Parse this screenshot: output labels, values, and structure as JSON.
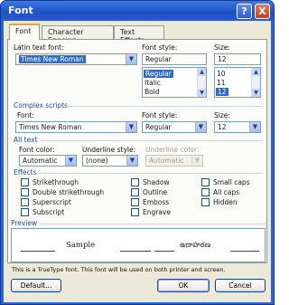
{
  "window": {
    "title": "Font",
    "help_label": "?",
    "close_label": "X"
  },
  "tabs": [
    {
      "label": "Font",
      "active": true
    },
    {
      "label": "Character Spacing",
      "active": false
    },
    {
      "label": "Text Effects",
      "active": false
    }
  ],
  "latin": {
    "font_label": "Latin text font:",
    "font_value": "Times New Roman",
    "style_label": "Font style:",
    "style_value": "Regular",
    "style_options": [
      "Regular",
      "Italic",
      "Bold"
    ],
    "style_selected": "Regular",
    "size_label": "Size:",
    "size_value": "12",
    "size_options": [
      "10",
      "11",
      "12"
    ],
    "size_selected": "12"
  },
  "complex": {
    "section_label": "Complex scripts",
    "font_label": "Font:",
    "font_value": "Times New Roman",
    "style_label": "Font style:",
    "style_value": "Regular",
    "size_label": "Size:",
    "size_value": "12"
  },
  "all_text": {
    "section_label": "All text",
    "font_color_label": "Font color:",
    "font_color_value": "Automatic",
    "underline_style_label": "Underline style:",
    "underline_style_value": "(none)",
    "underline_color_label": "Underline color:",
    "underline_color_value": "Automatic"
  },
  "effects": {
    "section_label": "Effects",
    "col1": [
      "Strikethrough",
      "Double strikethrough",
      "Superscript",
      "Subscript"
    ],
    "col2": [
      "Shadow",
      "Outline",
      "Emboss",
      "Engrave"
    ],
    "col3": [
      "Small caps",
      "All caps",
      "Hidden"
    ]
  },
  "preview": {
    "section_label": "Preview",
    "sample_text": "Sample",
    "complex_sample_text": "ఉదాహరణ",
    "note": "This is a TrueType font. This font will be used on both printer and screen."
  },
  "buttons": {
    "default": "Default...",
    "ok": "OK",
    "cancel": "Cancel"
  },
  "colors": {
    "title_bar": "#1d4fc0",
    "section_text": "#1f4fb0",
    "selection": "#316ac5",
    "dialog_bg": "#ece9d8"
  }
}
